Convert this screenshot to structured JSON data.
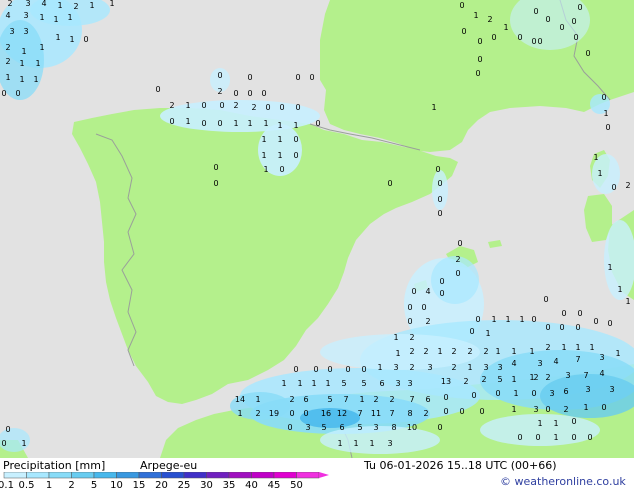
{
  "legend": {
    "title": "Precipitation [mm]",
    "model": "Arpege-eu",
    "valid": "Tu 06-01-2026 15..18 UTC (00+66)",
    "credit": "© weatheronline.co.uk",
    "stops": [
      "0.1",
      "0.5",
      "1",
      "2",
      "5",
      "10",
      "15",
      "20",
      "25",
      "30",
      "35",
      "40",
      "45",
      "50"
    ],
    "colors": [
      "#c8f0ff",
      "#a8e8ff",
      "#88dcf8",
      "#68ccf0",
      "#48b8ec",
      "#3898e0",
      "#3070d8",
      "#2850d0",
      "#4030c8",
      "#7020c0",
      "#a010c0",
      "#c000c8",
      "#e000d0",
      "#f030e0"
    ]
  },
  "map": {
    "colors": {
      "sea": "#e2e2e2",
      "land": "#b4f08c",
      "border": "#9aa09a",
      "coast": "#8c8c8c"
    },
    "values": [
      [
        "2",
        10,
        6
      ],
      [
        "3",
        28,
        6
      ],
      [
        "4",
        44,
        6
      ],
      [
        "1",
        60,
        8
      ],
      [
        "2",
        76,
        9
      ],
      [
        "1",
        92,
        8
      ],
      [
        "1",
        112,
        6
      ],
      [
        "4",
        8,
        18
      ],
      [
        "3",
        26,
        18
      ],
      [
        "1",
        42,
        20
      ],
      [
        "1",
        56,
        22
      ],
      [
        "1",
        70,
        20
      ],
      [
        "3",
        12,
        34
      ],
      [
        "3",
        26,
        34
      ],
      [
        "1",
        58,
        40
      ],
      [
        "1",
        72,
        42
      ],
      [
        "0",
        86,
        42
      ],
      [
        "2",
        8,
        50
      ],
      [
        "1",
        24,
        54
      ],
      [
        "1",
        42,
        50
      ],
      [
        "2",
        8,
        64
      ],
      [
        "1",
        22,
        66
      ],
      [
        "1",
        38,
        66
      ],
      [
        "1",
        8,
        80
      ],
      [
        "1",
        22,
        82
      ],
      [
        "1",
        36,
        82
      ],
      [
        "0",
        4,
        96
      ],
      [
        "0",
        18,
        96
      ],
      [
        "0",
        462,
        8
      ],
      [
        "1",
        476,
        18
      ],
      [
        "2",
        490,
        22
      ],
      [
        "1",
        506,
        30
      ],
      [
        "0",
        520,
        40
      ],
      [
        "0",
        534,
        44
      ],
      [
        "0",
        548,
        22
      ],
      [
        "0",
        562,
        30
      ],
      [
        "0",
        576,
        40
      ],
      [
        "0",
        580,
        10
      ],
      [
        "0",
        574,
        24
      ],
      [
        "0",
        588,
        56
      ],
      [
        "0",
        464,
        34
      ],
      [
        "0",
        480,
        44
      ],
      [
        "0",
        494,
        40
      ],
      [
        "0",
        536,
        14
      ],
      [
        "0",
        540,
        44
      ],
      [
        "0",
        480,
        62
      ],
      [
        "0",
        478,
        76
      ],
      [
        "0",
        604,
        100
      ],
      [
        "1",
        606,
        116
      ],
      [
        "0",
        608,
        130
      ],
      [
        "0",
        158,
        92
      ],
      [
        "2",
        220,
        94
      ],
      [
        "0",
        236,
        96
      ],
      [
        "0",
        250,
        96
      ],
      [
        "0",
        264,
        96
      ],
      [
        "0",
        220,
        78
      ],
      [
        "0",
        250,
        80
      ],
      [
        "0",
        298,
        80
      ],
      [
        "0",
        312,
        80
      ],
      [
        "2",
        172,
        108
      ],
      [
        "1",
        188,
        108
      ],
      [
        "0",
        204,
        108
      ],
      [
        "0",
        222,
        108
      ],
      [
        "2",
        236,
        108
      ],
      [
        "2",
        254,
        110
      ],
      [
        "0",
        268,
        110
      ],
      [
        "0",
        282,
        110
      ],
      [
        "0",
        298,
        110
      ],
      [
        "0",
        172,
        124
      ],
      [
        "1",
        188,
        124
      ],
      [
        "0",
        204,
        126
      ],
      [
        "0",
        220,
        126
      ],
      [
        "1",
        236,
        126
      ],
      [
        "1",
        250,
        126
      ],
      [
        "1",
        266,
        126
      ],
      [
        "1",
        280,
        128
      ],
      [
        "1",
        296,
        128
      ],
      [
        "0",
        318,
        126
      ],
      [
        "1",
        264,
        142
      ],
      [
        "1",
        280,
        142
      ],
      [
        "0",
        296,
        142
      ],
      [
        "1",
        264,
        158
      ],
      [
        "1",
        280,
        158
      ],
      [
        "0",
        296,
        158
      ],
      [
        "1",
        266,
        172
      ],
      [
        "0",
        282,
        172
      ],
      [
        "0",
        216,
        170
      ],
      [
        "0",
        216,
        186
      ],
      [
        "0",
        390,
        186
      ],
      [
        "1",
        434,
        110
      ],
      [
        "0",
        438,
        172
      ],
      [
        "0",
        440,
        186
      ],
      [
        "0",
        440,
        202
      ],
      [
        "0",
        440,
        216
      ],
      [
        "1",
        596,
        160
      ],
      [
        "1",
        600,
        176
      ],
      [
        "0",
        614,
        190
      ],
      [
        "2",
        628,
        188
      ],
      [
        "0",
        460,
        246
      ],
      [
        "2",
        458,
        262
      ],
      [
        "0",
        458,
        276
      ],
      [
        "0",
        442,
        284
      ],
      [
        "4",
        428,
        294
      ],
      [
        "0",
        442,
        296
      ],
      [
        "0",
        414,
        294
      ],
      [
        "0",
        410,
        310
      ],
      [
        "0",
        424,
        310
      ],
      [
        "0",
        410,
        324
      ],
      [
        "2",
        428,
        324
      ],
      [
        "2",
        412,
        340
      ],
      [
        "1",
        396,
        340
      ],
      [
        "0",
        478,
        322
      ],
      [
        "1",
        494,
        322
      ],
      [
        "1",
        508,
        322
      ],
      [
        "1",
        522,
        322
      ],
      [
        "0",
        534,
        322
      ],
      [
        "0",
        546,
        302
      ],
      [
        "0",
        564,
        316
      ],
      [
        "0",
        580,
        316
      ],
      [
        "0",
        548,
        330
      ],
      [
        "0",
        562,
        330
      ],
      [
        "0",
        578,
        330
      ],
      [
        "0",
        596,
        324
      ],
      [
        "0",
        610,
        326
      ],
      [
        "0",
        472,
        334
      ],
      [
        "1",
        488,
        336
      ],
      [
        "1",
        398,
        356
      ],
      [
        "2",
        412,
        354
      ],
      [
        "2",
        426,
        354
      ],
      [
        "1",
        440,
        354
      ],
      [
        "2",
        454,
        354
      ],
      [
        "2",
        470,
        354
      ],
      [
        "2",
        486,
        354
      ],
      [
        "1",
        498,
        354
      ],
      [
        "1",
        514,
        354
      ],
      [
        "1",
        532,
        354
      ],
      [
        "2",
        548,
        350
      ],
      [
        "1",
        564,
        350
      ],
      [
        "1",
        578,
        350
      ],
      [
        "1",
        592,
        350
      ],
      [
        "1",
        618,
        356
      ],
      [
        "2",
        454,
        370
      ],
      [
        "1",
        470,
        370
      ],
      [
        "3",
        486,
        370
      ],
      [
        "3",
        500,
        370
      ],
      [
        "4",
        514,
        366
      ],
      [
        "3",
        540,
        366
      ],
      [
        "4",
        556,
        364
      ],
      [
        "7",
        578,
        362
      ],
      [
        "3",
        602,
        360
      ],
      [
        "2",
        536,
        380
      ],
      [
        "2",
        548,
        380
      ],
      [
        "3",
        568,
        378
      ],
      [
        "7",
        586,
        378
      ],
      [
        "4",
        602,
        376
      ],
      [
        "1",
        284,
        386
      ],
      [
        "1",
        300,
        386
      ],
      [
        "1",
        314,
        386
      ],
      [
        "1",
        328,
        386
      ],
      [
        "5",
        344,
        386
      ],
      [
        "5",
        364,
        386
      ],
      [
        "6",
        382,
        386
      ],
      [
        "3",
        398,
        386
      ],
      [
        "3",
        410,
        386
      ],
      [
        "13",
        446,
        384
      ],
      [
        "2",
        466,
        384
      ],
      [
        "2",
        484,
        382
      ],
      [
        "5",
        500,
        382
      ],
      [
        "1",
        514,
        382
      ],
      [
        "1",
        532,
        380
      ],
      [
        "0",
        296,
        372
      ],
      [
        "0",
        316,
        372
      ],
      [
        "0",
        330,
        372
      ],
      [
        "0",
        348,
        372
      ],
      [
        "0",
        364,
        372
      ],
      [
        "1",
        380,
        370
      ],
      [
        "3",
        396,
        370
      ],
      [
        "2",
        412,
        370
      ],
      [
        "3",
        430,
        370
      ],
      [
        "2",
        292,
        402
      ],
      [
        "6",
        306,
        402
      ],
      [
        "5",
        330,
        402
      ],
      [
        "7",
        346,
        402
      ],
      [
        "1",
        362,
        402
      ],
      [
        "2",
        376,
        402
      ],
      [
        "2",
        392,
        402
      ],
      [
        "7",
        412,
        402
      ],
      [
        "6",
        428,
        402
      ],
      [
        "0",
        446,
        400
      ],
      [
        "0",
        474,
        398
      ],
      [
        "0",
        498,
        396
      ],
      [
        "1",
        516,
        396
      ],
      [
        "0",
        534,
        396
      ],
      [
        "3",
        552,
        396
      ],
      [
        "6",
        566,
        394
      ],
      [
        "3",
        588,
        392
      ],
      [
        "3",
        612,
        392
      ],
      [
        "14",
        240,
        402
      ],
      [
        "1",
        258,
        402
      ],
      [
        "1",
        240,
        416
      ],
      [
        "2",
        258,
        416
      ],
      [
        "19",
        274,
        416
      ],
      [
        "0",
        292,
        416
      ],
      [
        "0",
        306,
        416
      ],
      [
        "16",
        326,
        416
      ],
      [
        "12",
        342,
        416
      ],
      [
        "7",
        360,
        416
      ],
      [
        "11",
        376,
        416
      ],
      [
        "7",
        392,
        416
      ],
      [
        "8",
        410,
        416
      ],
      [
        "2",
        426,
        416
      ],
      [
        "0",
        446,
        414
      ],
      [
        "0",
        462,
        414
      ],
      [
        "0",
        482,
        414
      ],
      [
        "1",
        514,
        412
      ],
      [
        "3",
        536,
        412
      ],
      [
        "0",
        548,
        412
      ],
      [
        "2",
        566,
        412
      ],
      [
        "1",
        586,
        410
      ],
      [
        "0",
        604,
        410
      ],
      [
        "0",
        290,
        430
      ],
      [
        "3",
        308,
        430
      ],
      [
        "5",
        324,
        430
      ],
      [
        "6",
        342,
        430
      ],
      [
        "5",
        360,
        430
      ],
      [
        "3",
        376,
        430
      ],
      [
        "8",
        394,
        430
      ],
      [
        "10",
        412,
        430
      ],
      [
        "0",
        440,
        430
      ],
      [
        "1",
        540,
        426
      ],
      [
        "1",
        556,
        426
      ],
      [
        "0",
        574,
        424
      ],
      [
        "1",
        340,
        446
      ],
      [
        "1",
        356,
        446
      ],
      [
        "1",
        372,
        446
      ],
      [
        "3",
        390,
        446
      ],
      [
        "0",
        520,
        440
      ],
      [
        "0",
        538,
        440
      ],
      [
        "1",
        556,
        440
      ],
      [
        "0",
        574,
        440
      ],
      [
        "0",
        590,
        440
      ],
      [
        "0",
        8,
        432
      ],
      [
        "1",
        24,
        446
      ],
      [
        "0",
        4,
        446
      ],
      [
        "1",
        610,
        270
      ],
      [
        "1",
        620,
        292
      ],
      [
        "1",
        628,
        304
      ]
    ]
  }
}
